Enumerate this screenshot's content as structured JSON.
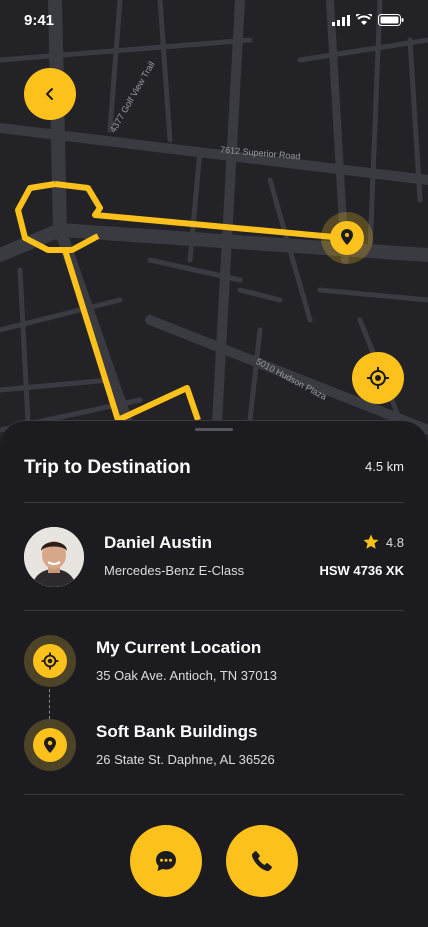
{
  "status_bar": {
    "time": "9:41"
  },
  "map": {
    "streets": [
      "4377 Golf View Trail",
      "7612 Superior Road",
      "5010 Hudson Plaza"
    ]
  },
  "trip": {
    "title": "Trip to Destination",
    "distance": "4.5 km"
  },
  "driver": {
    "name": "Daniel Austin",
    "car": "Mercedes-Benz E-Class",
    "rating": "4.8",
    "plate": "HSW 4736 XK"
  },
  "route": {
    "origin": {
      "title": "My Current Location",
      "address": "35 Oak Ave. Antioch, TN 37013"
    },
    "destination": {
      "title": "Soft Bank Buildings",
      "address": "26 State St. Daphne, AL 36526"
    }
  },
  "colors": {
    "accent": "#fcc21b",
    "background": "#1c1c20",
    "map": "#222227",
    "road": "#3a3a41"
  },
  "icons": {
    "back": "chevron-left-icon",
    "locate": "crosshair-icon",
    "pin": "map-pin-icon",
    "star": "star-icon",
    "chat": "chat-bubble-icon",
    "call": "phone-icon"
  }
}
